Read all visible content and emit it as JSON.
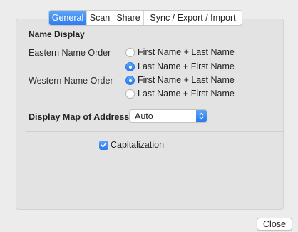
{
  "tabs": [
    {
      "label": "General",
      "active": true
    },
    {
      "label": "Scan",
      "active": false
    },
    {
      "label": "Share",
      "active": false
    },
    {
      "label": "Sync / Export / Import",
      "active": false
    }
  ],
  "name_display": {
    "heading": "Name Display",
    "eastern": {
      "label": "Eastern Name Order",
      "options": [
        "First Name + Last Name",
        "Last Name + First Name"
      ],
      "selected": "Last Name + First Name"
    },
    "western": {
      "label": "Western Name Order",
      "options": [
        "First Name + Last Name",
        "Last Name + First Name"
      ],
      "selected": "First Name + Last Name"
    }
  },
  "map": {
    "label": "Display Map of Address",
    "value": "Auto"
  },
  "capitalization": {
    "label": "Capitalization",
    "checked": true
  },
  "footer": {
    "close_label": "Close"
  },
  "colors": {
    "accent": "#2f7cf0"
  }
}
